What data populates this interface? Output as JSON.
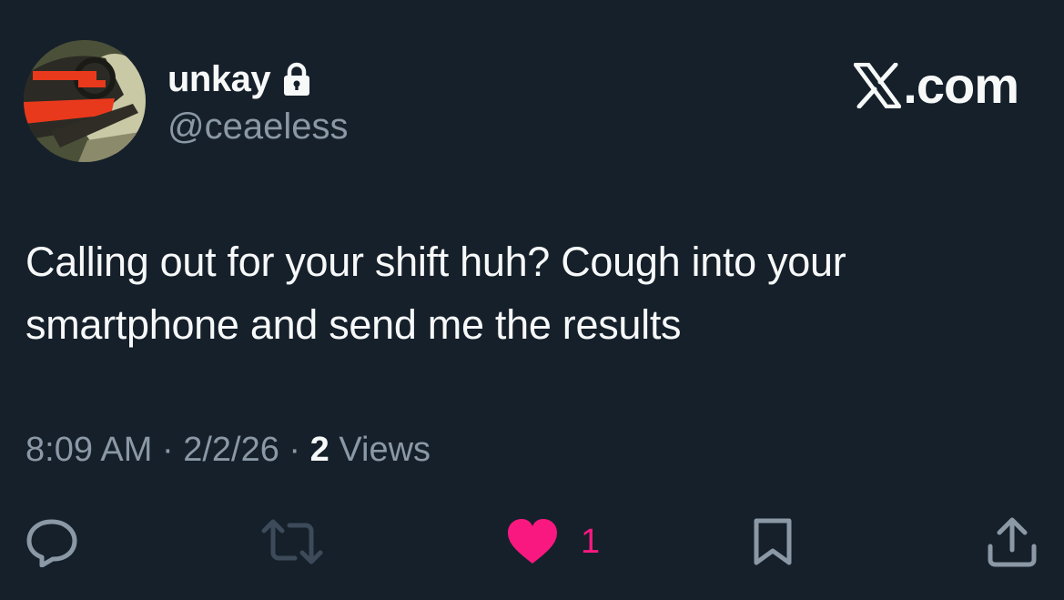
{
  "author": {
    "display_name": "unkay",
    "handle": "@ceaeless",
    "protected": true
  },
  "brand": {
    "text": ".com",
    "icon": "x-logo-icon"
  },
  "tweet": {
    "text": "Calling out for your shift huh? Cough into your smartphone and send me the results"
  },
  "meta": {
    "time": "8:09 AM",
    "separator": "·",
    "date": "2/2/26",
    "views_count": "2",
    "views_label": "Views"
  },
  "actions": {
    "reply": {
      "icon": "reply-icon"
    },
    "retweet": {
      "icon": "retweet-icon"
    },
    "like": {
      "icon": "heart-icon",
      "count": "1",
      "liked": true
    },
    "bookmark": {
      "icon": "bookmark-icon"
    },
    "share": {
      "icon": "share-icon"
    }
  },
  "colors": {
    "background": "#15202b",
    "text": "#f7f9f9",
    "muted": "#8b98a5",
    "like": "#f91880"
  }
}
